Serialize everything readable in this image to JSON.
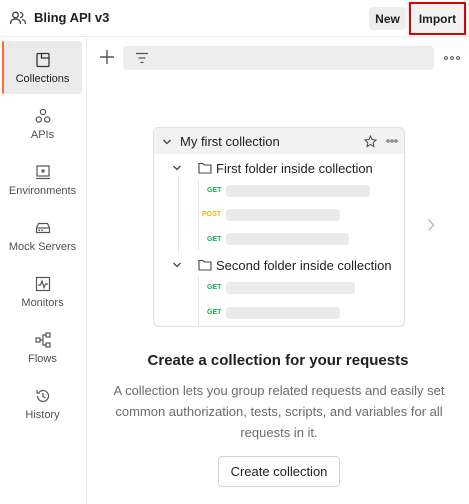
{
  "header": {
    "workspace_icon": "team-icon",
    "workspace_title": "Bling API v3",
    "new_label": "New",
    "import_label": "Import",
    "highlight_color": "#e00000"
  },
  "sidebar": {
    "accent_color": "#ff6c37",
    "items": [
      {
        "label": "Collections",
        "icon": "collections-icon",
        "active": true
      },
      {
        "label": "APIs",
        "icon": "apis-icon",
        "active": false
      },
      {
        "label": "Environments",
        "icon": "environments-icon",
        "active": false
      },
      {
        "label": "Mock Servers",
        "icon": "mock-servers-icon",
        "active": false
      },
      {
        "label": "Monitors",
        "icon": "monitors-icon",
        "active": false
      },
      {
        "label": "Flows",
        "icon": "flows-icon",
        "active": false
      },
      {
        "label": "History",
        "icon": "history-icon",
        "active": false
      }
    ]
  },
  "toolbar": {
    "add_icon": "plus-icon",
    "filter_icon": "filter-icon",
    "more_icon": "more-horizontal-icon"
  },
  "illustration": {
    "collection_name": "My first collection",
    "folders": [
      {
        "name": "First folder inside collection",
        "requests": [
          "GET",
          "POST",
          "GET"
        ]
      },
      {
        "name": "Second folder inside collection",
        "requests": [
          "GET",
          "GET"
        ]
      }
    ],
    "method_colors": {
      "GET": "#0cbb52",
      "POST": "#ffb400"
    }
  },
  "empty_state": {
    "title": "Create a collection for your requests",
    "description": "A collection lets you group related requests and easily set common authorization, tests, scripts, and variables for all requests in it.",
    "button_label": "Create collection"
  }
}
